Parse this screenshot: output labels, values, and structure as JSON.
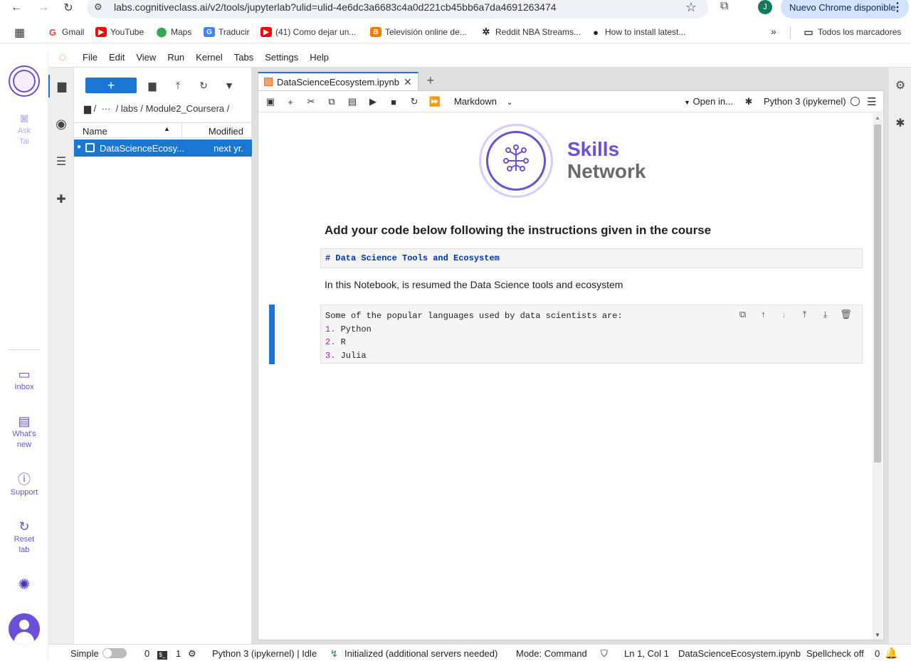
{
  "browser": {
    "url": "labs.cognitiveclass.ai/v2/tools/jupyterlab?ulid=ulid-4e6dc3a6683c4a0d221cb45bb6a7da4691263474",
    "profile_initial": "J",
    "update_label": "Nuevo Chrome disponible",
    "bookmarks": [
      {
        "label": "Gmail",
        "icon": "gmail-icon",
        "color": "#ea4335"
      },
      {
        "label": "YouTube",
        "icon": "youtube-icon",
        "color": "#ff0000"
      },
      {
        "label": "Maps",
        "icon": "maps-icon",
        "color": "#34a853"
      },
      {
        "label": "Traducir",
        "icon": "translate-icon",
        "color": "#4285f4"
      },
      {
        "label": "(41) Como dejar un...",
        "icon": "youtube-icon",
        "color": "#ff0000"
      },
      {
        "label": "Televisión online de...",
        "icon": "blogger-icon",
        "color": "#f57c00"
      },
      {
        "label": "Reddit NBA Streams...",
        "icon": "basketball-icon",
        "color": "#222222"
      },
      {
        "label": "How to install latest...",
        "icon": "github-icon",
        "color": "#222222"
      }
    ],
    "all_bookmarks": "Todos los marcadores"
  },
  "skills_sidebar": {
    "ask": "Ask",
    "tai": "Tai",
    "inbox": "Inbox",
    "whats": "What's",
    "new": "new",
    "support": "Support",
    "reset": "Reset",
    "lab": "lab"
  },
  "menubar": [
    "File",
    "Edit",
    "View",
    "Run",
    "Kernel",
    "Tabs",
    "Settings",
    "Help"
  ],
  "file_browser": {
    "breadcrumb": "/  ···  / labs / Module2_Coursera /",
    "col_name": "Name",
    "col_modified": "Modified",
    "file_name": "DataScienceEcosy...",
    "file_modified": "next yr."
  },
  "notebook": {
    "tab_title": "DataScienceEcosystem.ipynb",
    "cell_type": "Markdown",
    "open_in": "Open in...",
    "kernel": "Python 3 (ipykernel)",
    "brand_top": "Skills",
    "brand_bottom": "Network",
    "heading": "Add your code below following the instructions given in the course",
    "raw_cell": "# Data Science Tools and Ecosystem",
    "paragraph": "In this Notebook, is resumed the Data Science tools and ecosystem",
    "code_intro": "Some of the popular languages used by data scientists are:",
    "list": [
      {
        "num": "1.",
        "text": "Python"
      },
      {
        "num": "2.",
        "text": "R"
      },
      {
        "num": "3.",
        "text": "Julia"
      }
    ]
  },
  "status": {
    "mode": "Simple",
    "terminals": "0",
    "kernels": "1",
    "kernel_status": "Python 3 (ipykernel) | Idle",
    "lsp": "Initialized (additional servers needed)",
    "command_mode": "Mode: Command",
    "position": "Ln 1, Col 1",
    "file": "DataScienceEcosystem.ipynb",
    "spellcheck": "Spellcheck off",
    "notifications": "0"
  },
  "colors": {
    "accent": "#1976d2",
    "brand_purple": "#6b4fd8",
    "jupyter_orange": "#f37626"
  }
}
